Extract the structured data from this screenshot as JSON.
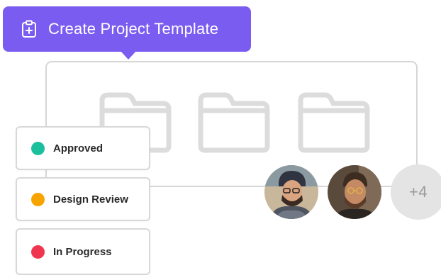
{
  "tooltip": {
    "label": "Create Project Template",
    "icon": "clipboard-plus-icon",
    "background": "#7b5cf0"
  },
  "project_card": {
    "folders": [
      "folder-icon",
      "folder-icon",
      "folder-icon"
    ]
  },
  "statuses": [
    {
      "label": "Approved",
      "color": "#1bbf9e"
    },
    {
      "label": "Design Review",
      "color": "#f7a400"
    },
    {
      "label": "In Progress",
      "color": "#f0354f"
    }
  ],
  "avatars": {
    "members": [
      "avatar-1",
      "avatar-2"
    ],
    "more_count": "+4"
  }
}
